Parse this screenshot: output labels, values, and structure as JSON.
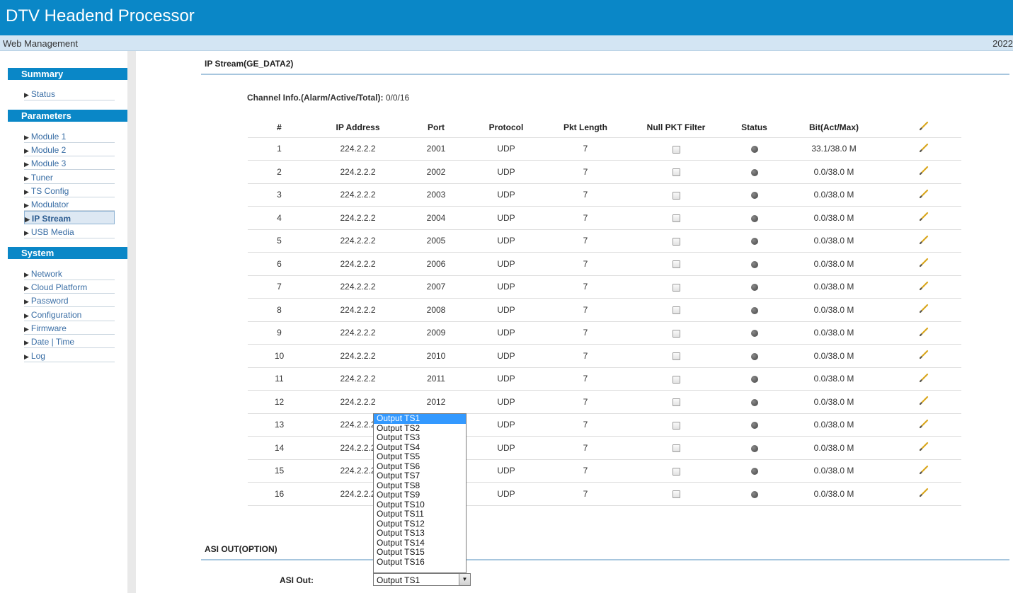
{
  "header": {
    "title": "DTV Headend Processor"
  },
  "subbar": {
    "left": "Web Management",
    "right": "2022"
  },
  "sidebar": {
    "summary": {
      "title": "Summary",
      "items": [
        "Status"
      ]
    },
    "parameters": {
      "title": "Parameters",
      "items": [
        "Module 1",
        "Module 2",
        "Module 3",
        "Tuner",
        "TS Config",
        "Modulator",
        "IP Stream",
        "USB Media"
      ]
    },
    "system": {
      "title": "System",
      "items": [
        "Network",
        "Cloud Platform",
        "Password",
        "Configuration",
        "Firmware",
        "Date | Time",
        "Log"
      ]
    },
    "active": "IP Stream"
  },
  "main": {
    "section_title": "IP Stream(GE_DATA2)",
    "channel_info_label": "Channel Info.(Alarm/Active/Total):",
    "channel_info_value": "0/0/16",
    "columns": [
      "#",
      "IP Address",
      "Port",
      "Protocol",
      "Pkt Length",
      "Null PKT Filter",
      "Status",
      "Bit(Act/Max)"
    ],
    "rows": [
      {
        "num": "1",
        "ip": "224.2.2.2",
        "port": "2001",
        "protocol": "UDP",
        "pkt_length": "7",
        "bitrate": "33.1/38.0 M"
      },
      {
        "num": "2",
        "ip": "224.2.2.2",
        "port": "2002",
        "protocol": "UDP",
        "pkt_length": "7",
        "bitrate": "0.0/38.0 M"
      },
      {
        "num": "3",
        "ip": "224.2.2.2",
        "port": "2003",
        "protocol": "UDP",
        "pkt_length": "7",
        "bitrate": "0.0/38.0 M"
      },
      {
        "num": "4",
        "ip": "224.2.2.2",
        "port": "2004",
        "protocol": "UDP",
        "pkt_length": "7",
        "bitrate": "0.0/38.0 M"
      },
      {
        "num": "5",
        "ip": "224.2.2.2",
        "port": "2005",
        "protocol": "UDP",
        "pkt_length": "7",
        "bitrate": "0.0/38.0 M"
      },
      {
        "num": "6",
        "ip": "224.2.2.2",
        "port": "2006",
        "protocol": "UDP",
        "pkt_length": "7",
        "bitrate": "0.0/38.0 M"
      },
      {
        "num": "7",
        "ip": "224.2.2.2",
        "port": "2007",
        "protocol": "UDP",
        "pkt_length": "7",
        "bitrate": "0.0/38.0 M"
      },
      {
        "num": "8",
        "ip": "224.2.2.2",
        "port": "2008",
        "protocol": "UDP",
        "pkt_length": "7",
        "bitrate": "0.0/38.0 M"
      },
      {
        "num": "9",
        "ip": "224.2.2.2",
        "port": "2009",
        "protocol": "UDP",
        "pkt_length": "7",
        "bitrate": "0.0/38.0 M"
      },
      {
        "num": "10",
        "ip": "224.2.2.2",
        "port": "2010",
        "protocol": "UDP",
        "pkt_length": "7",
        "bitrate": "0.0/38.0 M"
      },
      {
        "num": "11",
        "ip": "224.2.2.2",
        "port": "2011",
        "protocol": "UDP",
        "pkt_length": "7",
        "bitrate": "0.0/38.0 M"
      },
      {
        "num": "12",
        "ip": "224.2.2.2",
        "port": "2012",
        "protocol": "UDP",
        "pkt_length": "7",
        "bitrate": "0.0/38.0 M"
      },
      {
        "num": "13",
        "ip": "224.2.2.2",
        "port": "",
        "protocol": "UDP",
        "pkt_length": "7",
        "bitrate": "0.0/38.0 M"
      },
      {
        "num": "14",
        "ip": "224.2.2.2",
        "port": "",
        "protocol": "UDP",
        "pkt_length": "7",
        "bitrate": "0.0/38.0 M"
      },
      {
        "num": "15",
        "ip": "224.2.2.2",
        "port": "",
        "protocol": "UDP",
        "pkt_length": "7",
        "bitrate": "0.0/38.0 M"
      },
      {
        "num": "16",
        "ip": "224.2.2.2",
        "port": "",
        "protocol": "UDP",
        "pkt_length": "7",
        "bitrate": "0.0/38.0 M"
      }
    ],
    "asi_section_title": "ASI OUT(OPTION)",
    "asi_label": "ASI Out:",
    "asi_selected": "Output TS1",
    "asi_options": [
      "Output TS1",
      "Output TS2",
      "Output TS3",
      "Output TS4",
      "Output TS5",
      "Output TS6",
      "Output TS7",
      "Output TS8",
      "Output TS9",
      "Output TS10",
      "Output TS11",
      "Output TS12",
      "Output TS13",
      "Output TS14",
      "Output TS15",
      "Output TS16"
    ]
  },
  "icons": {
    "row_edit": "pencil-icon",
    "header_edit": "pencil-icon",
    "status": "status-dot-icon",
    "nav_arrow": "triangle-right-icon"
  },
  "colors": {
    "brand": "#0a87c7",
    "subbar": "#d3e5f3",
    "link": "#3a6ea5",
    "dropdown_highlight": "#3399ff"
  }
}
